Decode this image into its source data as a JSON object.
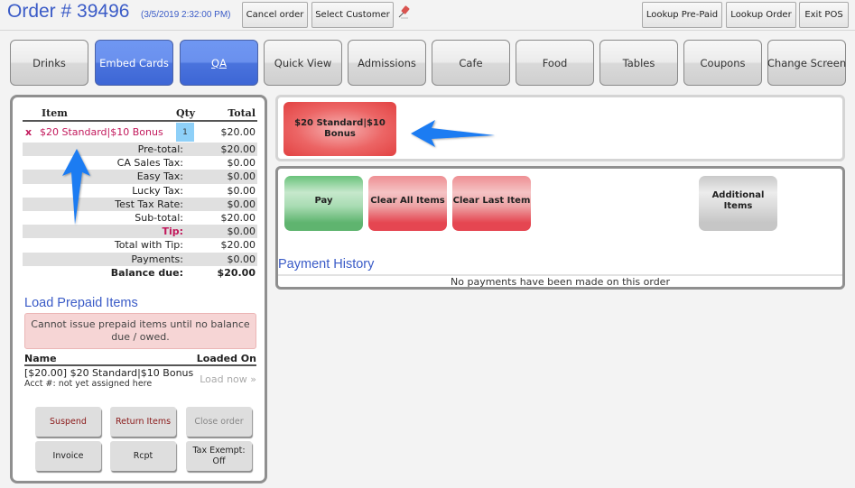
{
  "header": {
    "order_title": "Order # 39496",
    "order_datetime": "(3/5/2019 2:32:00 PM)",
    "buttons": {
      "cancel_order": "Cancel order",
      "select_customer": "Select Customer",
      "lookup_prepaid": "Lookup Pre-Paid",
      "lookup_order": "Lookup Order",
      "exit_pos": "Exit POS"
    },
    "pin_icon": "pushpin-icon"
  },
  "categories": [
    {
      "label": "Drinks",
      "active": false
    },
    {
      "label": "Embed Cards",
      "active": true
    },
    {
      "label": "QA",
      "active": true
    },
    {
      "label": "Quick View",
      "active": false
    },
    {
      "label": "Admissions",
      "active": false
    },
    {
      "label": "Cafe",
      "active": false
    },
    {
      "label": "Food",
      "active": false
    },
    {
      "label": "Tables",
      "active": false
    },
    {
      "label": "Coupons",
      "active": false
    },
    {
      "label": "Change Screen",
      "active": false
    }
  ],
  "order": {
    "columns": {
      "item": "Item",
      "qty": "Qty",
      "total": "Total"
    },
    "items": [
      {
        "remove": "x",
        "name": "$20 Standard|$10 Bonus",
        "qty": "1",
        "total": "$20.00"
      }
    ],
    "summary": [
      {
        "label": "Pre-total:",
        "value": "$20.00"
      },
      {
        "label": "CA Sales Tax:",
        "value": "$0.00"
      },
      {
        "label": "Easy Tax:",
        "value": "$0.00"
      },
      {
        "label": "Lucky Tax:",
        "value": "$0.00"
      },
      {
        "label": "Test Tax Rate:",
        "value": "$0.00"
      },
      {
        "label": "Sub-total:",
        "value": "$20.00"
      },
      {
        "label": "Tip:",
        "value": "$0.00"
      },
      {
        "label": "Total with Tip:",
        "value": "$20.00"
      },
      {
        "label": "Payments:",
        "value": "$0.00"
      },
      {
        "label": "Balance due:",
        "value": "$20.00"
      }
    ]
  },
  "prepaid": {
    "title": "Load Prepaid Items",
    "alert": "Cannot issue prepaid items until no balance due / owed.",
    "columns": {
      "name": "Name",
      "loaded_on": "Loaded On"
    },
    "rows": [
      {
        "name": "[$20.00] $20 Standard|$10 Bonus",
        "acct": "Acct #: not yet assigned here",
        "action": "Load now »"
      }
    ]
  },
  "order_actions": {
    "suspend": "Suspend",
    "return_items": "Return Items",
    "close_order": "Close order",
    "invoice": "Invoice",
    "rcpt": "Rcpt",
    "tax_exempt": "Tax Exempt: Off"
  },
  "selected_item": {
    "label": "$20 Standard|$10 Bonus"
  },
  "actions": {
    "pay": "Pay",
    "clear_all": "Clear All Items",
    "clear_last": "Clear Last Item",
    "additional": "Additional Items"
  },
  "payment_history": {
    "title": "Payment History",
    "empty": "No payments have been made on this order"
  },
  "colors": {
    "accent_blue": "#3a5bc7",
    "active_tab": "#4a73dd",
    "item_red": "#c2185b",
    "pay_green": "#5fb46f",
    "clear_red": "#e54651",
    "arrow_blue": "#1e7cf2"
  }
}
